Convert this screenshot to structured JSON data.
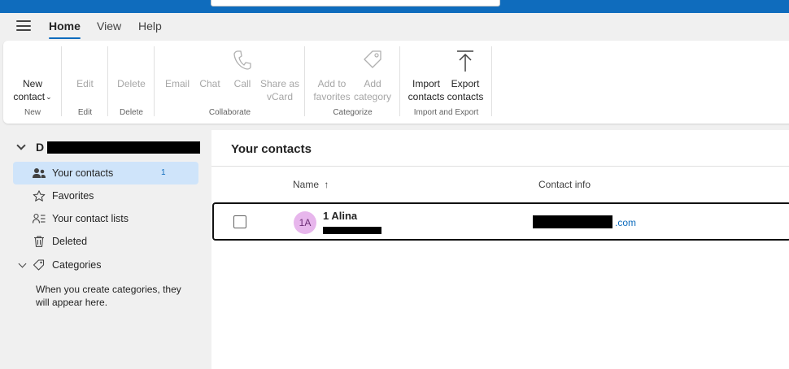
{
  "tabs": [
    {
      "label": "Home",
      "active": true
    },
    {
      "label": "View",
      "active": false
    },
    {
      "label": "Help",
      "active": false
    }
  ],
  "ribbon": {
    "groups": [
      {
        "label": "New",
        "buttons": [
          {
            "label": "New",
            "label2": "contact",
            "disabled": false,
            "dropdown": true
          }
        ]
      },
      {
        "label": "Edit",
        "buttons": [
          {
            "label": "Edit",
            "disabled": true
          }
        ]
      },
      {
        "label": "Delete",
        "buttons": [
          {
            "label": "Delete",
            "disabled": true
          }
        ]
      },
      {
        "label": "Collaborate",
        "buttons": [
          {
            "label": "Email",
            "disabled": true
          },
          {
            "label": "Chat",
            "disabled": true
          },
          {
            "label": "Call",
            "disabled": true,
            "icon": "phone-icon"
          },
          {
            "label": "Share as",
            "label2": "vCard",
            "disabled": true
          }
        ]
      },
      {
        "label": "Categorize",
        "buttons": [
          {
            "label": "Add to",
            "label2": "favorites",
            "disabled": true
          },
          {
            "label": "Add",
            "label2": "category",
            "disabled": true,
            "icon": "tag-icon"
          }
        ]
      },
      {
        "label": "Import and Export",
        "buttons": [
          {
            "label": "Import",
            "label2": "contacts",
            "disabled": false
          },
          {
            "label": "Export",
            "label2": "contacts",
            "disabled": false,
            "icon": "export-icon"
          }
        ]
      }
    ]
  },
  "sidebar": {
    "account_initial": "D",
    "items": [
      {
        "label": "Your contacts",
        "count": "1",
        "icon": "people-icon",
        "selected": true
      },
      {
        "label": "Favorites",
        "icon": "star-icon",
        "selected": false
      },
      {
        "label": "Your contact lists",
        "icon": "contact-list-icon",
        "selected": false
      },
      {
        "label": "Deleted",
        "icon": "trash-icon",
        "selected": false
      }
    ],
    "categories_label": "Categories",
    "categories_note": "When you create categories, they will appear here."
  },
  "main": {
    "title": "Your contacts",
    "columns": {
      "name": "Name",
      "name_sort": "↑",
      "contact_info": "Contact info"
    },
    "contacts": [
      {
        "initials": "1A",
        "name": "1 Alina",
        "email_suffix": ".com"
      }
    ]
  },
  "colors": {
    "brand": "#0f6cbd",
    "selected_nav": "#cfe4fa",
    "avatar_bg": "#e7b6ec",
    "avatar_fg": "#6b2d75"
  }
}
